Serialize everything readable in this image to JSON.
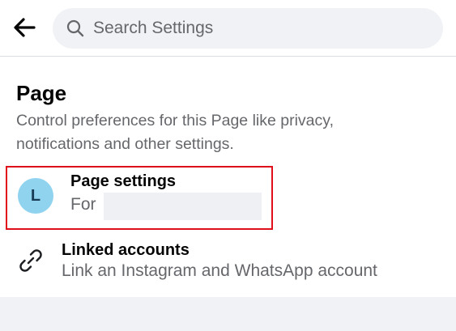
{
  "header": {
    "back_icon": "arrow-left-icon",
    "search": {
      "icon": "search-icon",
      "placeholder": "Search Settings",
      "value": ""
    }
  },
  "section": {
    "title": "Page",
    "description": "Control preferences for this Page like privacy, notifications and other settings."
  },
  "items": [
    {
      "title": "Page settings",
      "subtitle": "For",
      "avatar_letter": "L",
      "avatar_color": "#8fd3ef",
      "highlight_color": "#e0101a"
    },
    {
      "title": "Linked accounts",
      "subtitle": "Link an Instagram and WhatsApp account",
      "icon": "link-icon"
    }
  ]
}
